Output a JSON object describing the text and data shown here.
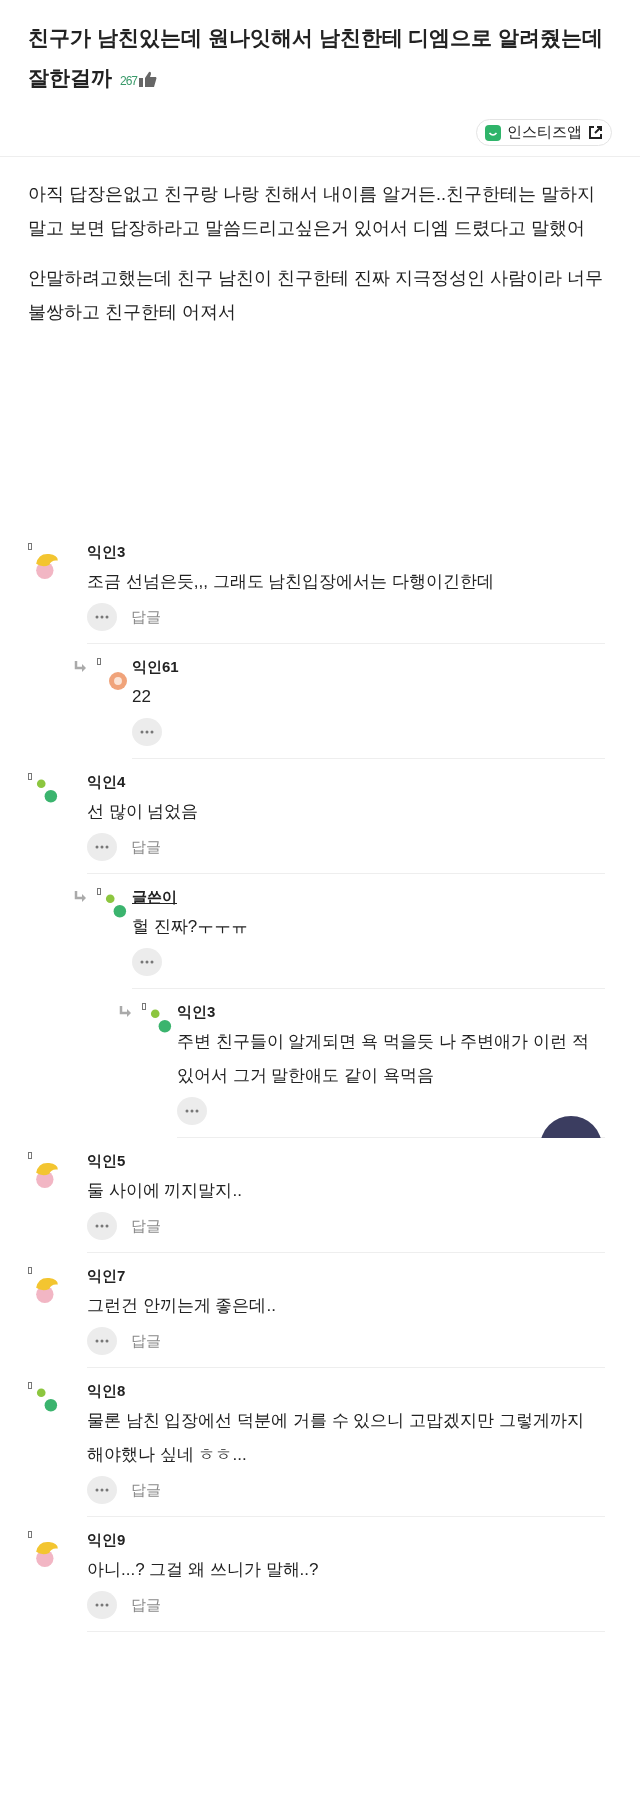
{
  "post": {
    "title": "친구가 남친있는데 원나잇해서 남친한테 디엠으로 알려줬는데 잘한걸까",
    "likes": "267",
    "app_button": "인스티즈앱",
    "paragraphs": [
      "아직 답장은없고 친구랑 나랑 친해서 내이름 알거든..친구한테는 말하지말고 보면 답장하라고 말씀드리고싶은거 있어서 디엠 드렸다고 말했어",
      "안말하려고했는데 친구 남친이 친구한테 진짜 지극정성인 사람이라 너무 불쌍하고 친구한테 어져서"
    ]
  },
  "comments": [
    {
      "author": "익인3",
      "avatar": {
        "kind": "sun"
      },
      "is_writer": false,
      "text": "조금 선넘은듯,,, 그래도 남친입장에서는 다행이긴한데",
      "reply_label": "답글",
      "children": [
        {
          "author": "익인61",
          "avatar": {
            "kind": "ring"
          },
          "is_writer": false,
          "text": "22"
        }
      ]
    },
    {
      "author": "익인4",
      "avatar": {
        "kind": "dots"
      },
      "is_writer": false,
      "text": "선 많이 넘었음",
      "reply_label": "답글",
      "children": [
        {
          "author": "글쓴이",
          "avatar": {
            "kind": "dots"
          },
          "is_writer": true,
          "text": "헐 진짜?ㅜㅜㅠ",
          "children": [
            {
              "author": "익인3",
              "avatar": {
                "kind": "dots"
              },
              "is_writer": false,
              "text": "주변 친구들이 알게되면 욕 먹을듯 나 주변애가 이런 적있어서 그거 말한애도 같이 욕먹음"
            }
          ]
        }
      ]
    },
    {
      "author": "익인5",
      "avatar": {
        "kind": "sun"
      },
      "is_writer": false,
      "text": "둘 사이에 끼지말지..",
      "reply_label": "답글"
    },
    {
      "author": "익인7",
      "avatar": {
        "kind": "sun"
      },
      "is_writer": false,
      "text": "그런건 안끼는게 좋은데..",
      "reply_label": "답글"
    },
    {
      "author": "익인8",
      "avatar": {
        "kind": "dots"
      },
      "is_writer": false,
      "text": "물론 남친 입장에선 덕분에 거를 수 있으니 고맙겠지만 그렇게까지 해야했나 싶네 ㅎㅎ...",
      "reply_label": "답글"
    },
    {
      "author": "익인9",
      "avatar": {
        "kind": "sun"
      },
      "is_writer": false,
      "text": "아니...? 그걸 왜 쓰니가 말해..?",
      "reply_label": "답글"
    }
  ]
}
